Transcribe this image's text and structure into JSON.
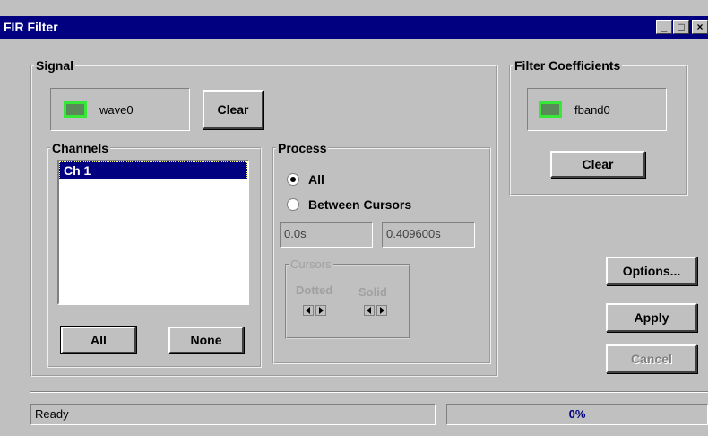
{
  "window": {
    "title": "FIR Filter",
    "controls": {
      "minimize": "_",
      "maximize": "□",
      "close": "×"
    }
  },
  "signal": {
    "legend": "Signal",
    "source": "wave0",
    "clear_label": "Clear",
    "channels": {
      "legend": "Channels",
      "items": [
        "Ch 1"
      ],
      "selected": "Ch 1",
      "all_label": "All",
      "none_label": "None"
    },
    "process": {
      "legend": "Process",
      "options": [
        "All",
        "Between Cursors"
      ],
      "selected": "All",
      "start_value": "0.0s",
      "end_value": "0.409600s",
      "cursors": {
        "legend": "Cursors",
        "dotted_label": "Dotted",
        "solid_label": "Solid"
      }
    }
  },
  "filter_coefficients": {
    "legend": "Filter Coefficients",
    "source": "fband0",
    "clear_label": "Clear"
  },
  "buttons": {
    "options_label": "Options...",
    "apply_label": "Apply",
    "cancel_label": "Cancel"
  },
  "status": {
    "text": "Ready",
    "progress": "0%"
  },
  "colors": {
    "titlebar": "#000080",
    "face": "#c0c0c0",
    "led_border": "#38e838",
    "selection": "#000080"
  }
}
